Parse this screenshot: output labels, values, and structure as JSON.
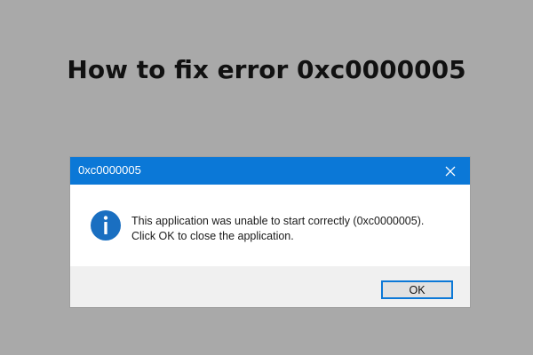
{
  "headline": "How to fix error 0xc0000005",
  "dialog": {
    "title": "0xc0000005",
    "message_line1": "This application was unable to start correctly (0xc0000005).",
    "message_line2": "Click OK to close the application.",
    "ok_label": "OK",
    "close_icon": "close-icon",
    "status_icon": "info-icon"
  },
  "colors": {
    "background": "#a9a9a9",
    "titlebar": "#0b78d7",
    "icon": "#1a6fc1",
    "footer": "#f0f0f0"
  }
}
